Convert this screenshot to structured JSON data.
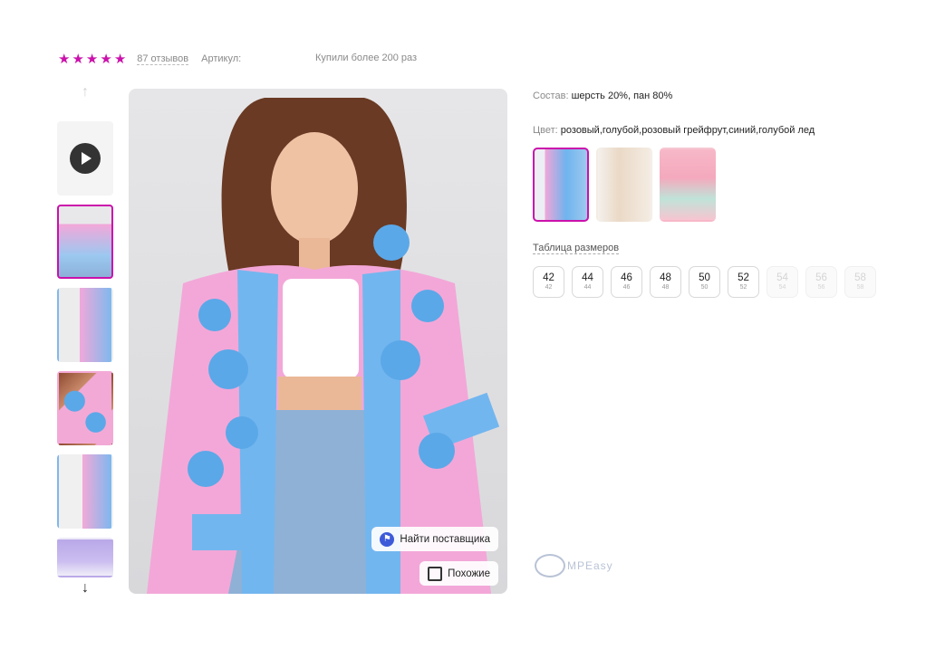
{
  "rating": {
    "stars": [
      "★",
      "★",
      "★",
      "★",
      "★"
    ],
    "reviews": "87 отзывов",
    "article_label": "Артикул:",
    "bought": "Купили более 200 раз"
  },
  "gallery": {
    "up_arrow": "↑",
    "down_arrow": "↓",
    "buttons": {
      "find_supplier": "Найти поставщика",
      "similar": "Похожие"
    }
  },
  "product": {
    "composition_label": "Состав:",
    "composition_value": "шерсть 20%, пан 80%",
    "color_label": "Цвет:",
    "color_value": "розовый,голубой,розовый грейфрут,синий,голубой лед",
    "size_table_link": "Таблица размеров",
    "sizes": [
      {
        "ru": "42",
        "intl": "42",
        "available": true
      },
      {
        "ru": "44",
        "intl": "44",
        "available": true
      },
      {
        "ru": "46",
        "intl": "46",
        "available": true
      },
      {
        "ru": "48",
        "intl": "48",
        "available": true
      },
      {
        "ru": "50",
        "intl": "50",
        "available": true
      },
      {
        "ru": "52",
        "intl": "52",
        "available": true
      },
      {
        "ru": "54",
        "intl": "54",
        "available": false
      },
      {
        "ru": "56",
        "intl": "56",
        "available": false
      },
      {
        "ru": "58",
        "intl": "58",
        "available": false
      }
    ]
  },
  "watermark": "MPEasy",
  "colors": {
    "accent": "#cb11ab",
    "supplier_icon": "#3d5bd9"
  }
}
